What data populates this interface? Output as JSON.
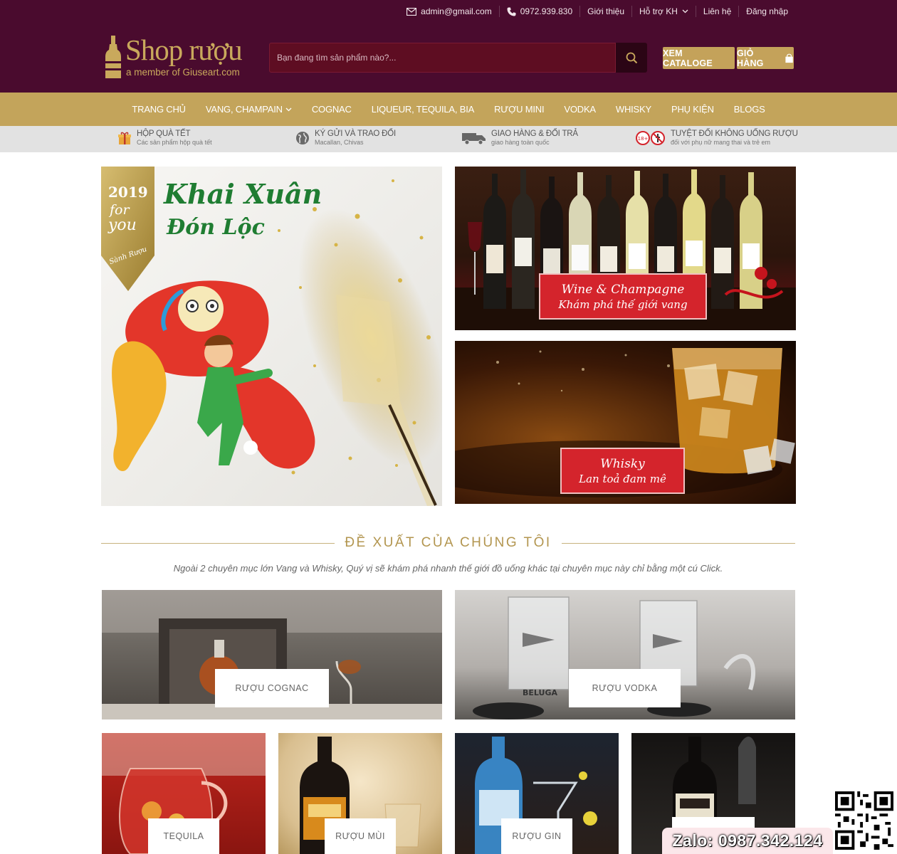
{
  "topbar": {
    "email": "admin@gmail.com",
    "phone": "0972.939.830",
    "about": "Giới thiệu",
    "support": "Hỗ trợ KH",
    "contact": "Liên hệ",
    "login": "Đăng nhập"
  },
  "logo": {
    "text": "Shop rượu",
    "sub": "a member of Giuseart.com"
  },
  "search": {
    "placeholder": "Bạn đang tìm sản phẩm nào?..."
  },
  "buttons": {
    "catalog": "XEM CATALOGE",
    "cart": "GIỎ HÀNG"
  },
  "nav": [
    "TRANG CHỦ",
    "VANG, CHAMPAIN",
    "COGNAC",
    "LIQUEUR, TEQUILA, BIA",
    "RƯỢU MINI",
    "VODKA",
    "WHISKY",
    "PHỤ KIỆN",
    "BLOGS"
  ],
  "features": [
    {
      "title": "HỘP QUÀ TẾT",
      "sub": "Các sản phẩm hộp quà tết"
    },
    {
      "title": "KÝ GỬI VÀ TRAO ĐỔI",
      "sub": "Macallan, Chivas"
    },
    {
      "title": "GIAO HÀNG & ĐỔI TRẢ",
      "sub": "giao hàng toàn quốc"
    },
    {
      "title": "TUYỆT ĐỐI KHÔNG UỐNG RƯỢU",
      "sub": "đối với phụ nữ mang thai và trẻ em"
    }
  ],
  "banners": {
    "big": {
      "year": "2019",
      "for": "for",
      "you": "you",
      "brand": "Sành Rượu",
      "line1": "Khai Xuân",
      "line2": "Đón Lộc"
    },
    "wine": {
      "line1": "Wine & Champagne",
      "line2": "Khám phá thế giới vang"
    },
    "whisky": {
      "line1": "Whisky",
      "line2": "Lan toả đam mê"
    }
  },
  "section": {
    "title": "ĐỀ XUẤT CỦA CHÚNG TÔI",
    "desc": "Ngoài 2 chuyên mục lớn Vang và Whisky, Quý vị sẽ khám phá nhanh thế giới đồ uống khác tại chuyên mục này chỉ bằng một cú Click."
  },
  "categories": {
    "cognac": "RƯỢU COGNAC",
    "vodka": "RƯỢU VODKA",
    "tequila": "TEQUILA",
    "mui": "RƯỢU MÙI",
    "gin": "RƯỢU GIN",
    "rum": ""
  },
  "zalo": "Zalo: 0987.342.124",
  "colors": {
    "header_bg": "#4a0b2e",
    "gold": "#c3a45b",
    "search_bg": "#5e0d22",
    "feature_bg": "#e2e2e2",
    "label_red": "#d4242c"
  }
}
